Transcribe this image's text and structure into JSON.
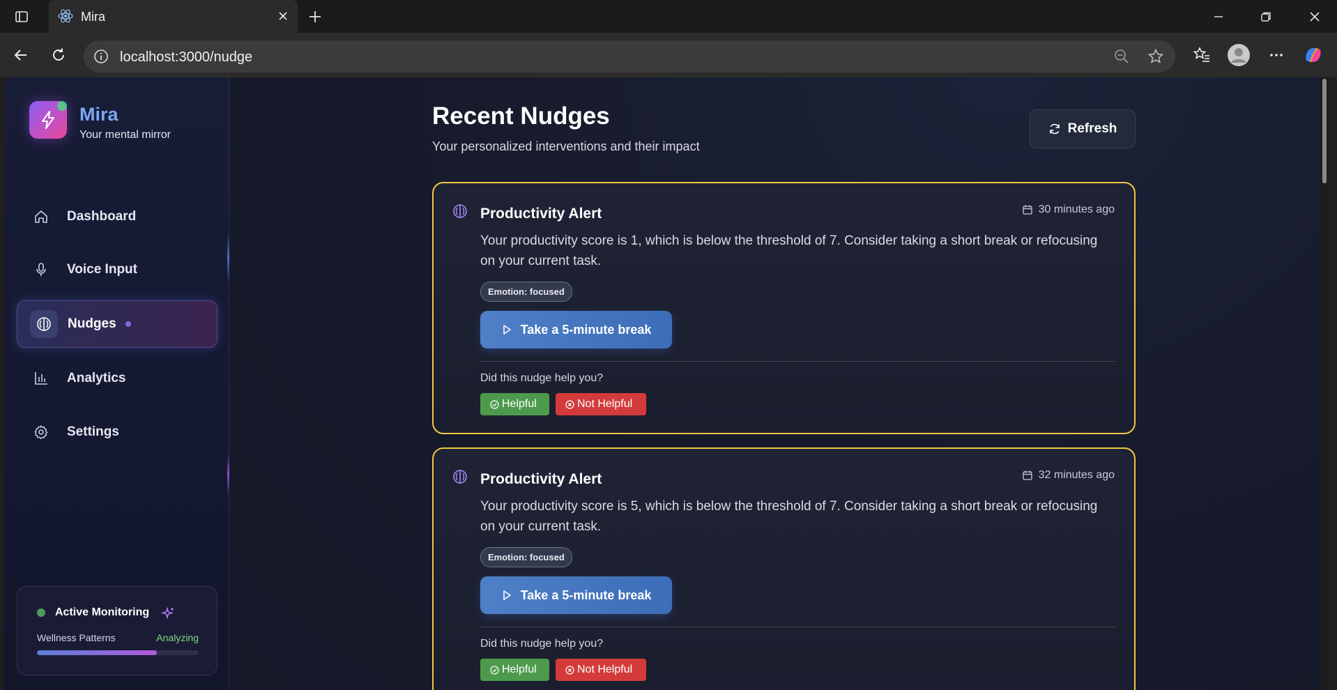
{
  "browser": {
    "tab_title": "Mira",
    "url": "localhost:3000/nudge"
  },
  "sidebar": {
    "app_name": "Mira",
    "tagline": "Your mental mirror",
    "items": [
      {
        "label": "Dashboard",
        "icon": "home-icon"
      },
      {
        "label": "Voice Input",
        "icon": "microphone-icon"
      },
      {
        "label": "Nudges",
        "icon": "brain-icon",
        "active": true
      },
      {
        "label": "Analytics",
        "icon": "bar-chart-icon"
      },
      {
        "label": "Settings",
        "icon": "gear-icon"
      }
    ],
    "monitor": {
      "title": "Active Monitoring",
      "label": "Wellness Patterns",
      "status": "Analyzing",
      "progress": 0.74
    }
  },
  "page": {
    "title": "Recent Nudges",
    "subtitle": "Your personalized interventions and their impact",
    "refresh_label": "Refresh"
  },
  "nudges": [
    {
      "title": "Productivity Alert",
      "time": "30 minutes ago",
      "message": "Your productivity score is 1, which is below the threshold of 7. Consider taking a short break or refocusing on your current task.",
      "emotion": "Emotion: focused",
      "action": "Take a 5-minute break",
      "question": "Did this nudge help you?",
      "helpful": "Helpful",
      "not_helpful": "Not Helpful"
    },
    {
      "title": "Productivity Alert",
      "time": "32 minutes ago",
      "message": "Your productivity score is 5, which is below the threshold of 7. Consider taking a short break or refocusing on your current task.",
      "emotion": "Emotion: focused",
      "action": "Take a 5-minute break",
      "question": "Did this nudge help you?",
      "helpful": "Helpful",
      "not_helpful": "Not Helpful"
    }
  ],
  "colors": {
    "card_border": "#f5c542",
    "accent": "#7aa7f5",
    "helpful": "#4d9a4d",
    "not_helpful": "#d33b3b"
  }
}
